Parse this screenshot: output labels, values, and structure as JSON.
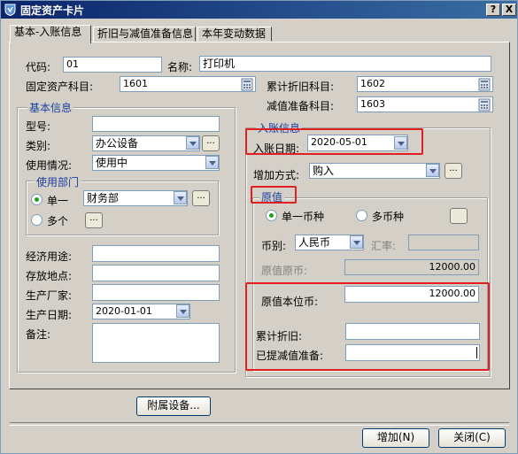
{
  "window": {
    "title": "固定资产卡片",
    "help_btn": "?",
    "close_btn": "X"
  },
  "tabs": [
    "基本-入账信息",
    "折旧与减值准备信息",
    "本年变动数据"
  ],
  "top": {
    "code_label": "代码:",
    "code_value": "01",
    "name_label": "名称:",
    "name_value": "打印机",
    "asset_account_label": "固定资产科目:",
    "asset_account_value": "1601",
    "accum_dep_label": "累计折旧科目:",
    "accum_dep_value": "1602",
    "impairment_label": "减值准备科目:",
    "impairment_value": "1603"
  },
  "basic": {
    "title": "基本信息",
    "model_label": "型号:",
    "model_value": "",
    "category_label": "类别:",
    "category_value": "办公设备",
    "usage_label": "使用情况:",
    "usage_value": "使用中",
    "dept_title": "使用部门",
    "single_label": "单一",
    "single_value": "财务部",
    "multi_label": "多个",
    "purpose_label": "经济用途:",
    "purpose_value": "",
    "location_label": "存放地点:",
    "location_value": "",
    "maker_label": "生产厂家:",
    "maker_value": "",
    "prod_date_label": "生产日期:",
    "prod_date_value": "2020-01-01",
    "remark_label": "备注:",
    "remark_value": ""
  },
  "entry": {
    "title": "入账信息",
    "date_label": "入账日期:",
    "date_value": "2020-05-01",
    "method_label": "增加方式:",
    "method_value": "购入",
    "orig_title": "原值",
    "single_currency": "单一币种",
    "multi_currency": "多币种",
    "currency_label": "币别:",
    "currency_value": "人民币",
    "rate_label": "汇率:",
    "rate_value": "",
    "orig_foreign_label": "原值原币:",
    "orig_foreign_value": "12000.00",
    "orig_local_label": "原值本位币:",
    "orig_local_value": "12000.00",
    "accum_label": "累计折旧:",
    "accum_value": "",
    "impair_label": "已提减值准备:",
    "impair_value": ""
  },
  "buttons": {
    "attach": "附属设备...",
    "add": "增加(N)",
    "close": "关闭(C)",
    "dots": "..."
  }
}
